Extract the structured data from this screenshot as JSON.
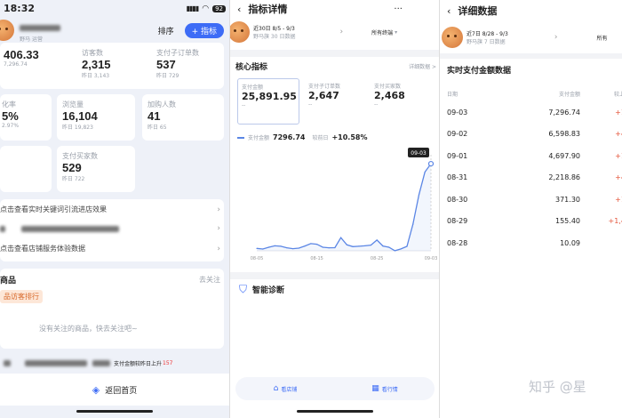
{
  "p1": {
    "time": "18:32",
    "battery": "92",
    "sort_label": "排序",
    "add_label": "+ 指标",
    "sub_a": "野马",
    "sub_b": "运营",
    "metrics": [
      {
        "label": "",
        "value": "406.33",
        "foot": "7,296.74"
      },
      {
        "label": "访客数",
        "value": "2,315",
        "foot": "昨日 3,143"
      },
      {
        "label": "支付子订单数",
        "value": "537",
        "foot": "昨日 729"
      },
      {
        "label": "化率",
        "value": "5%",
        "foot": "2.97%"
      },
      {
        "label": "浏览量",
        "value": "16,104",
        "foot": "昨日 19,823"
      },
      {
        "label": "加购人数",
        "value": "41",
        "foot": "昨日 65"
      },
      {
        "label": "",
        "value": "",
        "foot": ""
      },
      {
        "label": "支付买家数",
        "value": "529",
        "foot": "昨日 722"
      }
    ],
    "link1": "点击查看实时关键词引流进店效果",
    "link2": "点击查看店铺服务体验数据",
    "goods_title": "商品",
    "goods_action": "去关注",
    "goods_tab": "品访客排行",
    "empty_text": "没有关注的商品，快去关注吧~",
    "foot_note": "支付金额较昨日上升",
    "foot_num": "157",
    "home_label": "返回首页"
  },
  "p2": {
    "title": "指标详情",
    "date_range": "近30日 8/5 - 9/3",
    "date_sub": "野马旗 30 日数据",
    "filter": "所有终端",
    "core_title": "核心指标",
    "detail_link": "详细数据 >",
    "cards": [
      {
        "label": "支付金额",
        "value": "25,891.95",
        "foot": "--"
      },
      {
        "label": "支付子订单数",
        "value": "2,647",
        "foot": "--"
      },
      {
        "label": "支付买家数",
        "value": "2,468",
        "foot": "--"
      }
    ],
    "series_label": "支付金额",
    "series_value": "7296.74",
    "compare_label": "较前日",
    "compare_value": "+10.58%",
    "tooltip_date": "09-03",
    "diag_title": "智能诊断",
    "tab_shop": "看店铺",
    "tab_industry": "看行情"
  },
  "p3": {
    "title": "详细数据",
    "date_range": "近7日 8/28 - 9/3",
    "date_sub": "野马旗 7 日数据",
    "filter": "所有",
    "table_title": "实时支付金额数据",
    "col_date": "日期",
    "col_amount": "支付金额",
    "col_change": "较上一",
    "rows": [
      {
        "date": "09-03",
        "amount": "7,296.74",
        "change": "+10"
      },
      {
        "date": "09-02",
        "amount": "6,598.83",
        "change": "+40"
      },
      {
        "date": "09-01",
        "amount": "4,697.90",
        "change": "+11"
      },
      {
        "date": "08-31",
        "amount": "2,218.86",
        "change": "+49"
      },
      {
        "date": "08-30",
        "amount": "371.30",
        "change": "+13"
      },
      {
        "date": "08-29",
        "amount": "155.40",
        "change": "+1,44"
      },
      {
        "date": "08-28",
        "amount": "10.09",
        "change": "-"
      }
    ],
    "watermark": "知乎 @星"
  },
  "chart_data": {
    "type": "line",
    "title": "",
    "x_ticks": [
      "08-05",
      "08-15",
      "08-25",
      "09-03"
    ],
    "x": [
      "08-05",
      "08-06",
      "08-07",
      "08-08",
      "08-09",
      "08-10",
      "08-11",
      "08-12",
      "08-13",
      "08-14",
      "08-15",
      "08-16",
      "08-17",
      "08-18",
      "08-19",
      "08-20",
      "08-21",
      "08-22",
      "08-23",
      "08-24",
      "08-25",
      "08-26",
      "08-27",
      "08-28",
      "08-29",
      "08-30",
      "08-31",
      "09-01",
      "09-02",
      "09-03"
    ],
    "series": [
      {
        "values": [
          200,
          150,
          300,
          420,
          380,
          250,
          180,
          220,
          400,
          600,
          550,
          300,
          250,
          260,
          1100,
          500,
          350,
          380,
          420,
          480,
          900,
          400,
          300,
          10,
          155,
          371,
          2219,
          4698,
          6599,
          7297
        ]
      }
    ],
    "ylim": [
      0,
      7600
    ],
    "color": "#5b86e5",
    "grid": false
  }
}
